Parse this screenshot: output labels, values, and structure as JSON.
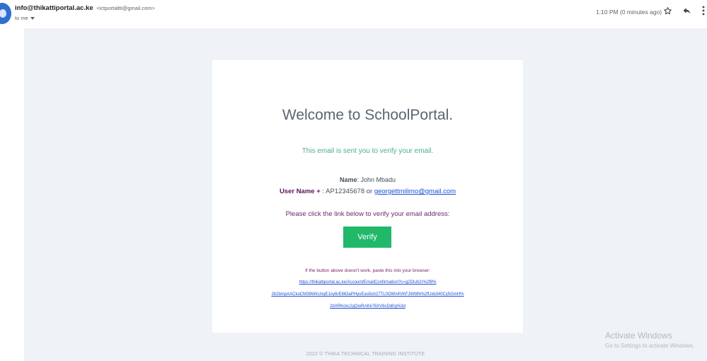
{
  "header": {
    "sender_name": "info@thikattiportal.ac.ke",
    "sender_address": "<ictportaltti@gmail.com>",
    "recipient": "to me",
    "timestamp": "1:10 PM (0 minutes ago)",
    "icons": {
      "star": "star-icon",
      "reply": "reply-icon",
      "more": "more-vert-icon"
    }
  },
  "email": {
    "welcome": "Welcome to SchoolPortal.",
    "sent_note": "This email is sent you to verify your email.",
    "name_label": "Name",
    "name_value": ": John Mbadu",
    "username_label": "User Name + ",
    "username_value": ": AP12345678 or ",
    "username_email": "georgettmilimo@gmail.com",
    "click_note": "Please click the link below to verify your email address:",
    "verify_button": "Verify",
    "fallback_note": "If the button above doesn't work, paste this into your browser:",
    "link_lines": [
      "https://thikattiportal.ac.ke/Account/EmailConfirmation?c=g2DIuh2r%2f8%",
      "2b2bmpAACkoCM38WkUnqE1oy6rE863aPHyoEas5oh27TL0OWn4VKFJWMN%2fUxb340Cy5GmH%",
      "2bXRKckc2gQioRAKk76XV6cDd0g%3d"
    ],
    "footer": "2022 © THIKA TECHNICAL TRAINING INSTITUTE",
    "button_color": "#21b86a"
  },
  "watermark": {
    "title": "Activate Windows",
    "subtitle": "Go to Settings to activate Windows."
  }
}
